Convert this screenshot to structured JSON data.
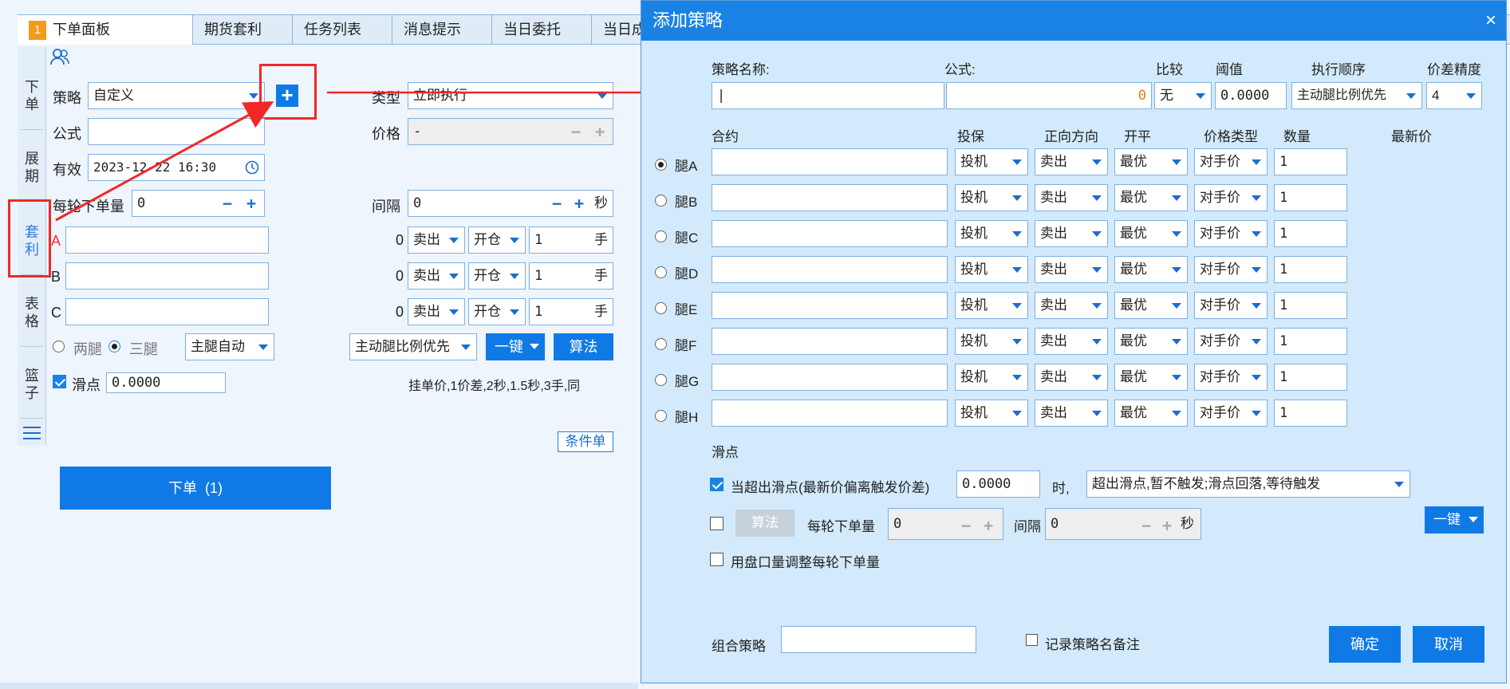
{
  "tabs": {
    "num": "1",
    "items": [
      "下单面板",
      "期货套利",
      "任务列表",
      "消息提示",
      "当日委托",
      "当日成"
    ]
  },
  "vtabs": [
    "下单",
    "展期",
    "套利",
    "表格",
    "篮子"
  ],
  "panel": {
    "strategy_label": "策略",
    "strategy_value": "自定义",
    "formula_label": "公式",
    "formula_value": "",
    "valid_label": "有效",
    "valid_value": "2023-12-22 16:30",
    "per_round_label": "每轮下单量",
    "per_round_value": "0",
    "type_label": "类型",
    "type_value": "立即执行",
    "price_label": "价格",
    "price_value": "-",
    "interval_label": "间隔",
    "interval_value": "0",
    "sec": "秒",
    "legs": [
      {
        "name": "A",
        "prefix": "0",
        "side": "卖出",
        "open": "开仓",
        "qty": "1",
        "unit": "手"
      },
      {
        "name": "B",
        "prefix": "0",
        "side": "卖出",
        "open": "开仓",
        "qty": "1",
        "unit": "手"
      },
      {
        "name": "C",
        "prefix": "0",
        "side": "卖出",
        "open": "开仓",
        "qty": "1",
        "unit": "手"
      }
    ],
    "two_leg": "两腿",
    "three_leg": "三腿",
    "main_leg": "主腿自动",
    "exec_order": "主动腿比例优先",
    "one_key": "一键",
    "algo": "算法",
    "slip_label": "滑点",
    "slip_value": "0.0000",
    "hang_text": "挂单价,1价差,2秒,1.5秒,3手,同",
    "cond_btn": "条件单",
    "order_btn": "下单  (1)"
  },
  "dialog": {
    "title": "添加策略",
    "close": "×",
    "h_name": "策略名称:",
    "h_formula": "公式:",
    "h_compare": "比较",
    "h_threshold": "阈值",
    "h_order": "执行顺序",
    "h_precision": "价差精度",
    "name_value": "|",
    "formula_count": "0",
    "compare_value": "无",
    "threshold_value": "0.0000",
    "order_value": "主动腿比例优先",
    "precision_value": "4",
    "h_contract": "合约",
    "h_hedge": "投保",
    "h_direction": "正向方向",
    "h_openclose": "开平",
    "h_pricetype": "价格类型",
    "h_qty": "数量",
    "h_latest": "最新价",
    "legs": [
      {
        "name": "腿A",
        "hedge": "投机",
        "dir": "卖出",
        "oc": "最优",
        "pt": "对手价",
        "qty": "1"
      },
      {
        "name": "腿B",
        "hedge": "投机",
        "dir": "卖出",
        "oc": "最优",
        "pt": "对手价",
        "qty": "1"
      },
      {
        "name": "腿C",
        "hedge": "投机",
        "dir": "卖出",
        "oc": "最优",
        "pt": "对手价",
        "qty": "1"
      },
      {
        "name": "腿D",
        "hedge": "投机",
        "dir": "卖出",
        "oc": "最优",
        "pt": "对手价",
        "qty": "1"
      },
      {
        "name": "腿E",
        "hedge": "投机",
        "dir": "卖出",
        "oc": "最优",
        "pt": "对手价",
        "qty": "1"
      },
      {
        "name": "腿F",
        "hedge": "投机",
        "dir": "卖出",
        "oc": "最优",
        "pt": "对手价",
        "qty": "1"
      },
      {
        "name": "腿G",
        "hedge": "投机",
        "dir": "卖出",
        "oc": "最优",
        "pt": "对手价",
        "qty": "1"
      },
      {
        "name": "腿H",
        "hedge": "投机",
        "dir": "卖出",
        "oc": "最优",
        "pt": "对手价",
        "qty": "1"
      }
    ],
    "slip_title": "滑点",
    "slip_check_label": "当超出滑点(最新价偏离触发价差)",
    "slip_value": "0.0000",
    "slip_when": "时,",
    "slip_action": "超出滑点,暂不触发;滑点回落,等待触发",
    "algo_btn": "算法",
    "per_round_label": "每轮下单量",
    "per_round_value": "0",
    "interval_label": "间隔",
    "interval_value": "0",
    "sec": "秒",
    "one_key": "一键",
    "adjust_label": "用盘口量调整每轮下单量",
    "combo_label": "组合策略",
    "combo_value": "",
    "remark_label": "记录策略名备注",
    "ok": "确定",
    "cancel": "取消"
  }
}
